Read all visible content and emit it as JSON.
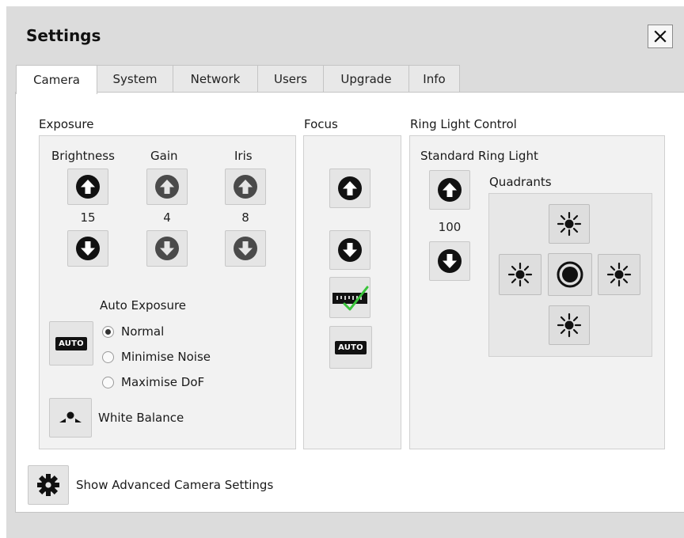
{
  "window": {
    "title": "Settings",
    "close_icon": "close-icon"
  },
  "tabs": [
    {
      "label": "Camera",
      "active": true
    },
    {
      "label": "System",
      "active": false
    },
    {
      "label": "Network",
      "active": false
    },
    {
      "label": "Users",
      "active": false
    },
    {
      "label": "Upgrade",
      "active": false
    },
    {
      "label": "Info",
      "active": false
    }
  ],
  "exposure": {
    "section_label": "Exposure",
    "brightness": {
      "label": "Brightness",
      "value": "15"
    },
    "gain": {
      "label": "Gain",
      "value": "4"
    },
    "iris": {
      "label": "Iris",
      "value": "8"
    },
    "auto_exposure": {
      "label": "Auto Exposure",
      "button_text": "AUTO",
      "options": [
        "Normal",
        "Minimise Noise",
        "Maximise DoF"
      ],
      "selected": "Normal"
    },
    "white_balance": {
      "label": "White Balance"
    }
  },
  "focus": {
    "section_label": "Focus",
    "auto_text": "AUTO"
  },
  "ring_light": {
    "section_label": "Ring Light Control",
    "standard_label": "Standard Ring Light",
    "value": "100",
    "quadrants_label": "Quadrants"
  },
  "advanced": {
    "label": "Show Advanced Camera Settings"
  },
  "colors": {
    "enabled_icon": "#111111",
    "disabled_icon": "#4a4a4a",
    "check": "#39c43a"
  }
}
